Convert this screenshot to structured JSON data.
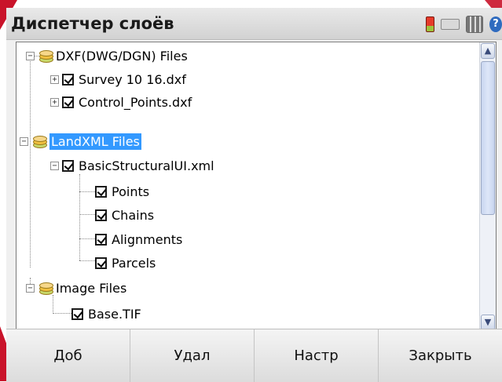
{
  "window": {
    "title": "Диспетчер слоёв"
  },
  "tray": {
    "icons": [
      "battery-icon",
      "keyboard-icon",
      "apps-icon",
      "help-icon"
    ],
    "help_glyph": "?"
  },
  "tree": {
    "nodes": [
      {
        "label": "DXF(DWG/DGN) Files",
        "type": "group",
        "expander": "−",
        "selected": false
      },
      {
        "label": "Survey 10 16.dxf",
        "type": "file",
        "checked": true,
        "expander": "+"
      },
      {
        "label": "Control_Points.dxf",
        "type": "file",
        "checked": true,
        "expander": "+"
      },
      {
        "label": "LandXML Files",
        "type": "group",
        "expander": "−",
        "selected": true
      },
      {
        "label": "BasicStructuralUI.xml",
        "type": "file",
        "checked": true,
        "expander": "−"
      },
      {
        "label": "Points",
        "type": "layer",
        "checked": true
      },
      {
        "label": "Chains",
        "type": "layer",
        "checked": true
      },
      {
        "label": "Alignments",
        "type": "layer",
        "checked": true
      },
      {
        "label": "Parcels",
        "type": "layer",
        "checked": true
      },
      {
        "label": "Image Files",
        "type": "group",
        "expander": "−",
        "selected": false
      },
      {
        "label": "Base.TIF",
        "type": "file",
        "checked": true
      }
    ]
  },
  "scrollbar": {
    "up_glyph": "▲",
    "down_glyph": "▼"
  },
  "buttons": {
    "add": "Доб",
    "delete": "Удал",
    "settings": "Настр",
    "close": "Закрыть"
  },
  "colors": {
    "selection": "#3399ff",
    "accent": "#c9132a"
  }
}
